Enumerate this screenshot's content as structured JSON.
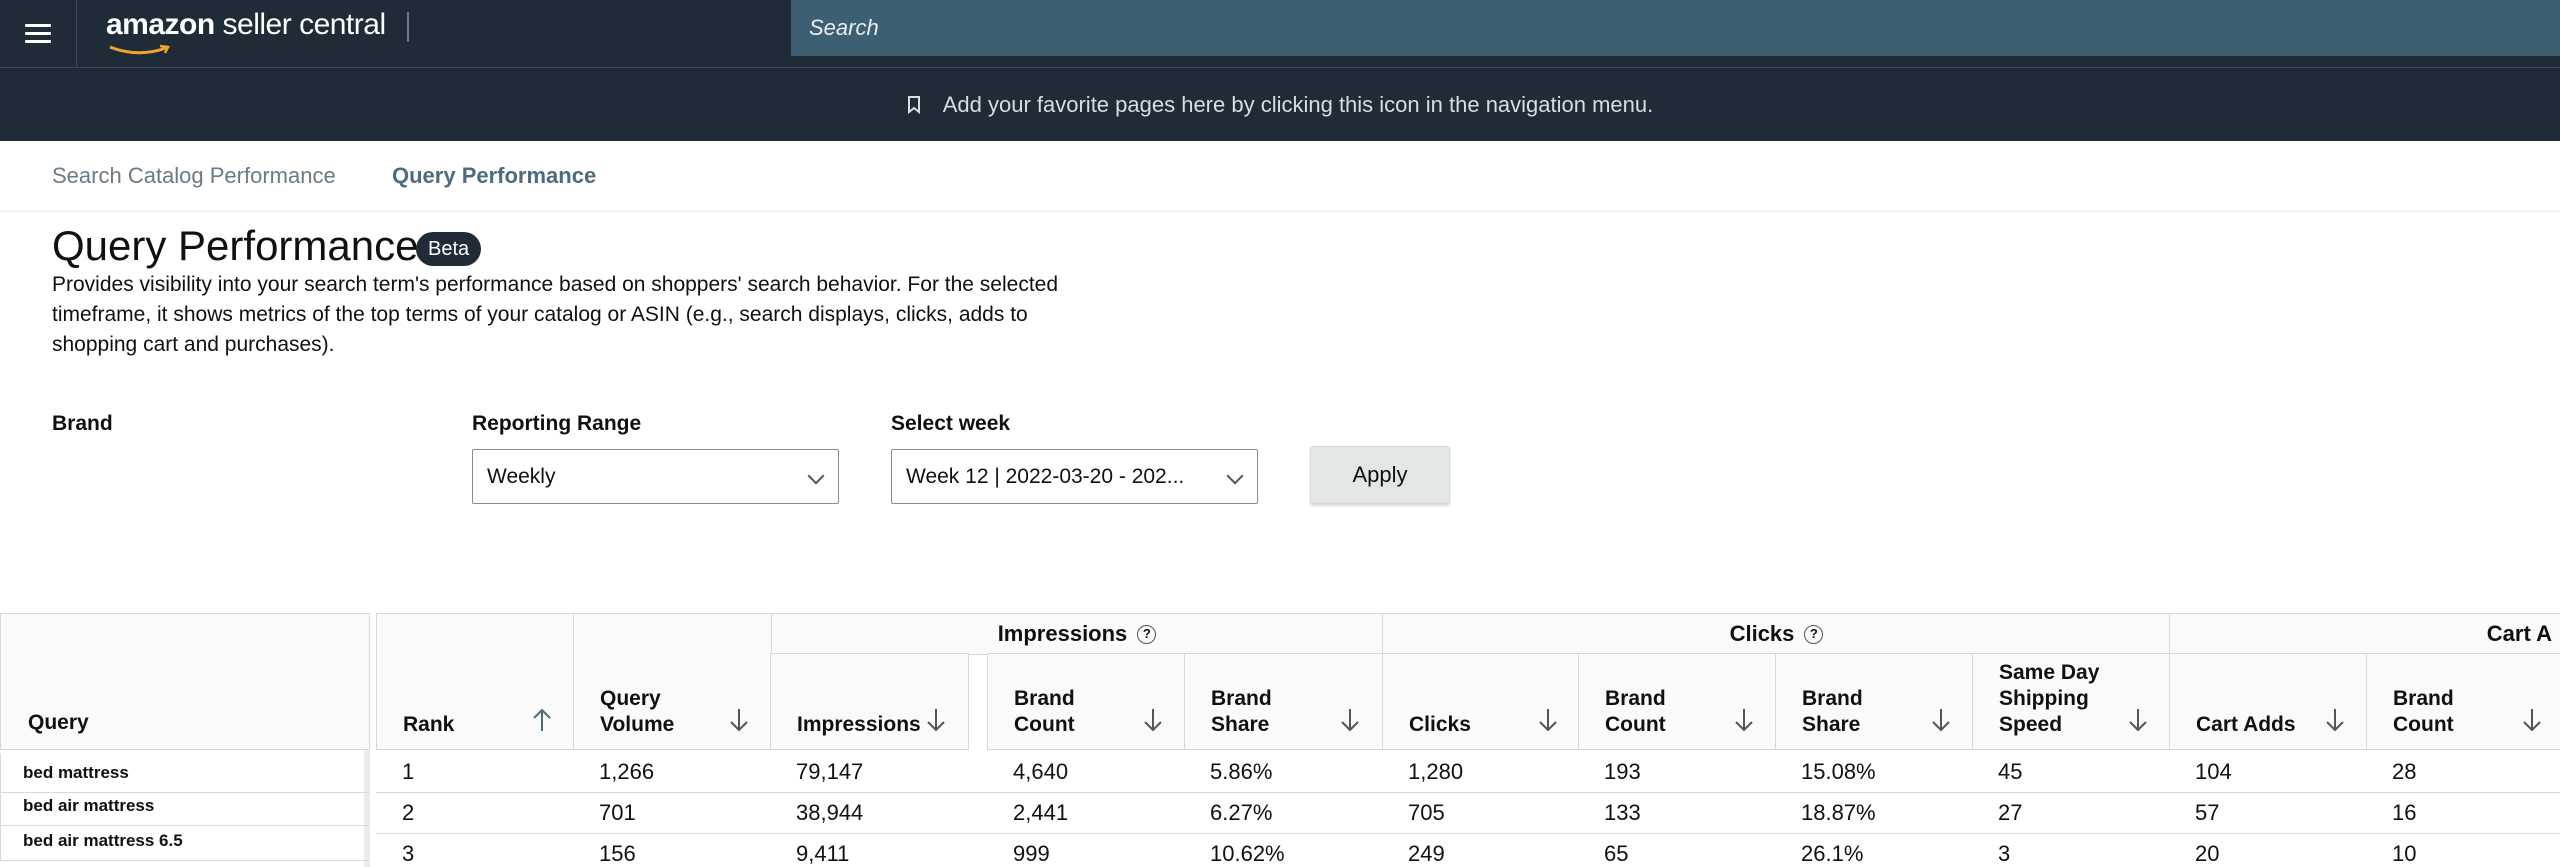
{
  "nav": {
    "logo_bold": "amazon",
    "logo_rest": " seller central",
    "search_placeholder": "Search",
    "favorites_hint": "Add your favorite pages here by clicking this icon in the navigation menu."
  },
  "tabs": [
    {
      "label": "Search Catalog Performance",
      "active": false
    },
    {
      "label": "Query Performance",
      "active": true
    }
  ],
  "page": {
    "title": "Query Performance",
    "badge": "Beta",
    "description": "Provides visibility into your search term's performance based on shoppers' search behavior. For the selected timeframe, it shows metrics of the top terms of your catalog or ASIN (e.g., search displays, clicks, adds to shopping cart and purchases)."
  },
  "filters": {
    "brand_label": "Brand",
    "range_label": "Reporting Range",
    "range_value": "Weekly",
    "week_label": "Select week",
    "week_value": "Week 12 | 2022-03-20 - 202...",
    "apply_label": "Apply"
  },
  "table": {
    "query_header": "Query",
    "groups": [
      "Impressions",
      "Clicks",
      "Cart A"
    ],
    "help_glyph": "?",
    "columns": [
      [
        "Rank"
      ],
      [
        "Query",
        "Volume"
      ],
      [
        "Impressions"
      ],
      [
        "Brand",
        "Count"
      ],
      [
        "Brand",
        "Share"
      ],
      [
        "Clicks"
      ],
      [
        "Brand",
        "Count"
      ],
      [
        "Brand",
        "Share"
      ],
      [
        "Same Day",
        "Shipping",
        "Speed"
      ],
      [
        "Cart Adds"
      ],
      [
        "Brand",
        "Count"
      ]
    ],
    "queries": [
      "bed mattress",
      "bed air mattress",
      "bed air mattress 6.5"
    ],
    "rows": [
      [
        "1",
        "1,266",
        "79,147",
        "4,640",
        "5.86%",
        "1,280",
        "193",
        "15.08%",
        "45",
        "104",
        "28"
      ],
      [
        "2",
        "701",
        "38,944",
        "2,441",
        "6.27%",
        "705",
        "133",
        "18.87%",
        "27",
        "57",
        "16"
      ],
      [
        "3",
        "156",
        "9,411",
        "999",
        "10.62%",
        "249",
        "65",
        "26.1%",
        "3",
        "20",
        "10"
      ]
    ]
  }
}
